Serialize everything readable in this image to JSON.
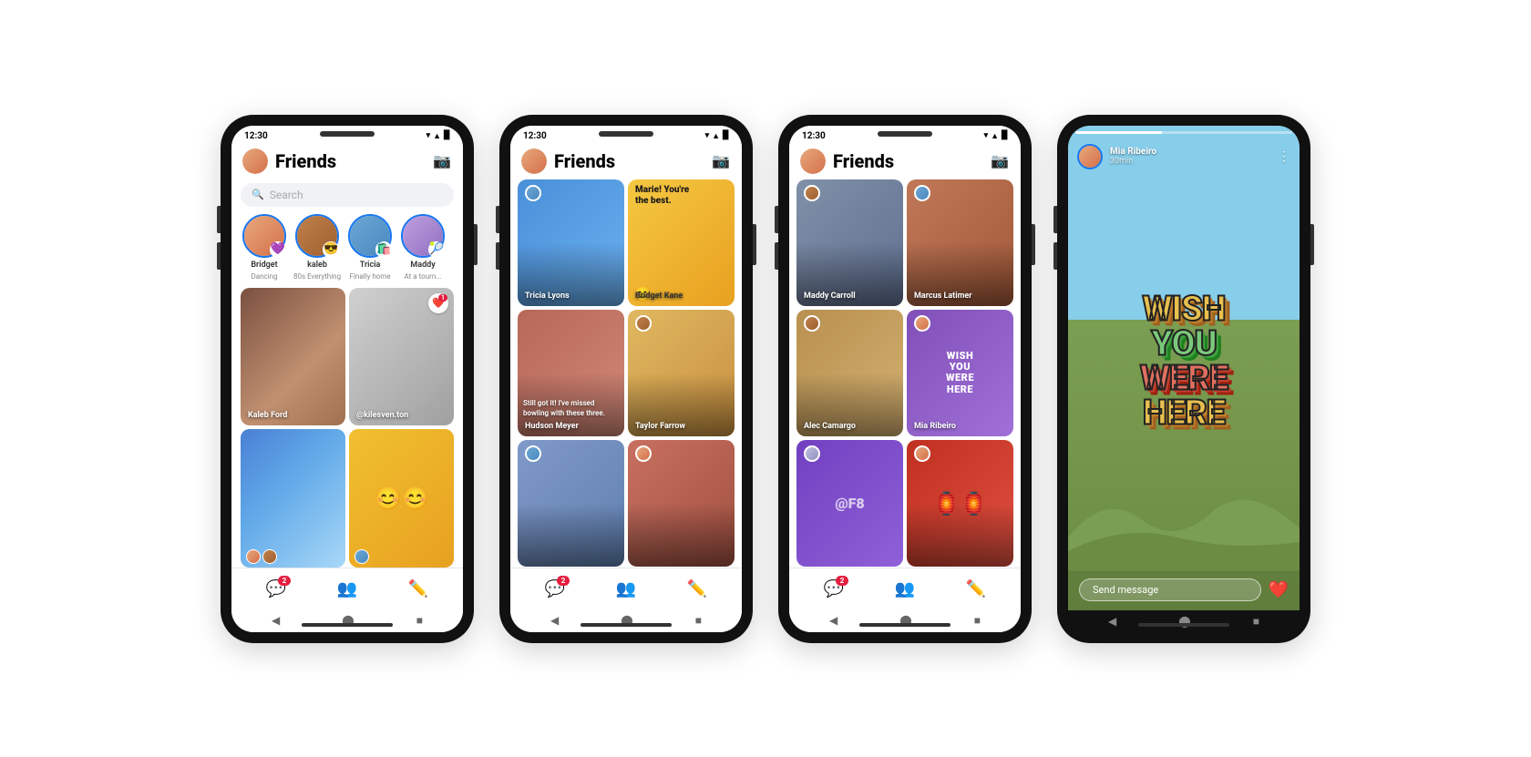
{
  "page": {
    "background": "#ffffff"
  },
  "phones": [
    {
      "id": "phone1",
      "type": "friends_list",
      "status_time": "12:30",
      "header_title": "Friends",
      "search_placeholder": "Search",
      "stories": [
        {
          "name": "Bridget",
          "sub": "Dancing",
          "emoji": "💜"
        },
        {
          "name": "kaleb",
          "sub": "80s Everything",
          "emoji": "😎"
        },
        {
          "name": "Tricia",
          "sub": "Finally home",
          "emoji": "🛍️"
        },
        {
          "name": "Maddy",
          "sub": "At a tourn...",
          "emoji": "🎾"
        }
      ],
      "grid_items": [
        {
          "label": "Kaleb Ford",
          "type": "photo_dark_group"
        },
        {
          "label": "@kilesven.ton",
          "type": "photo_dog",
          "heart_notif": true,
          "heart_count": "1"
        },
        {
          "label": "",
          "type": "photo_blue_wave"
        },
        {
          "label": "",
          "type": "photo_emoji_float"
        }
      ],
      "nav": [
        {
          "icon": "💬",
          "badge": "2"
        },
        {
          "icon": "👥",
          "badge": null
        },
        {
          "icon": "✏️",
          "badge": null
        }
      ]
    },
    {
      "id": "phone2",
      "type": "friends_stories",
      "status_time": "12:30",
      "header_title": "Friends",
      "grid_items": [
        {
          "label": "Tricia Lyons",
          "type": "photo_tricia",
          "title": null
        },
        {
          "label": "Bridget Kane",
          "type": "photo_bridget",
          "title": "Marie! You're the best."
        },
        {
          "label": "Hudson Meyer",
          "type": "photo_bowling",
          "text": "Still got it! I've missed bowling with these three."
        },
        {
          "label": "Taylor Farrow",
          "type": "photo_taylor"
        },
        {
          "label": "",
          "type": "photo_blue_hair"
        },
        {
          "label": "",
          "type": "photo_red_hair"
        }
      ],
      "nav": [
        {
          "icon": "💬",
          "badge": "2"
        },
        {
          "icon": "👥",
          "badge": null
        },
        {
          "icon": "✏️",
          "badge": null
        }
      ]
    },
    {
      "id": "phone3",
      "type": "friends_grid",
      "status_time": "12:30",
      "header_title": "Friends",
      "grid_items": [
        {
          "label": "Maddy Carroll",
          "type": "photo_maddy"
        },
        {
          "label": "Marcus Latimer",
          "type": "photo_marcus"
        },
        {
          "label": "Alec Camargo",
          "type": "photo_alec"
        },
        {
          "label": "Mia Ribeiro",
          "type": "photo_wish",
          "text": "WISH YOU WERE HERE"
        },
        {
          "label": "",
          "type": "photo_purple_glow"
        },
        {
          "label": "",
          "type": "photo_lanterns"
        }
      ],
      "nav": [
        {
          "icon": "💬",
          "badge": "2"
        },
        {
          "icon": "👥",
          "badge": null
        },
        {
          "icon": "✏️",
          "badge": null
        }
      ]
    },
    {
      "id": "phone4",
      "type": "story_view",
      "story_user": "Mia Ribeiro",
      "story_time": "30min",
      "wish_lines": [
        "WISH",
        "YOU",
        "WERE",
        "HERE"
      ],
      "send_placeholder": "Send message",
      "nav": [
        {
          "icon": "◀"
        },
        {
          "icon": "⬤"
        },
        {
          "icon": "■"
        }
      ]
    }
  ]
}
